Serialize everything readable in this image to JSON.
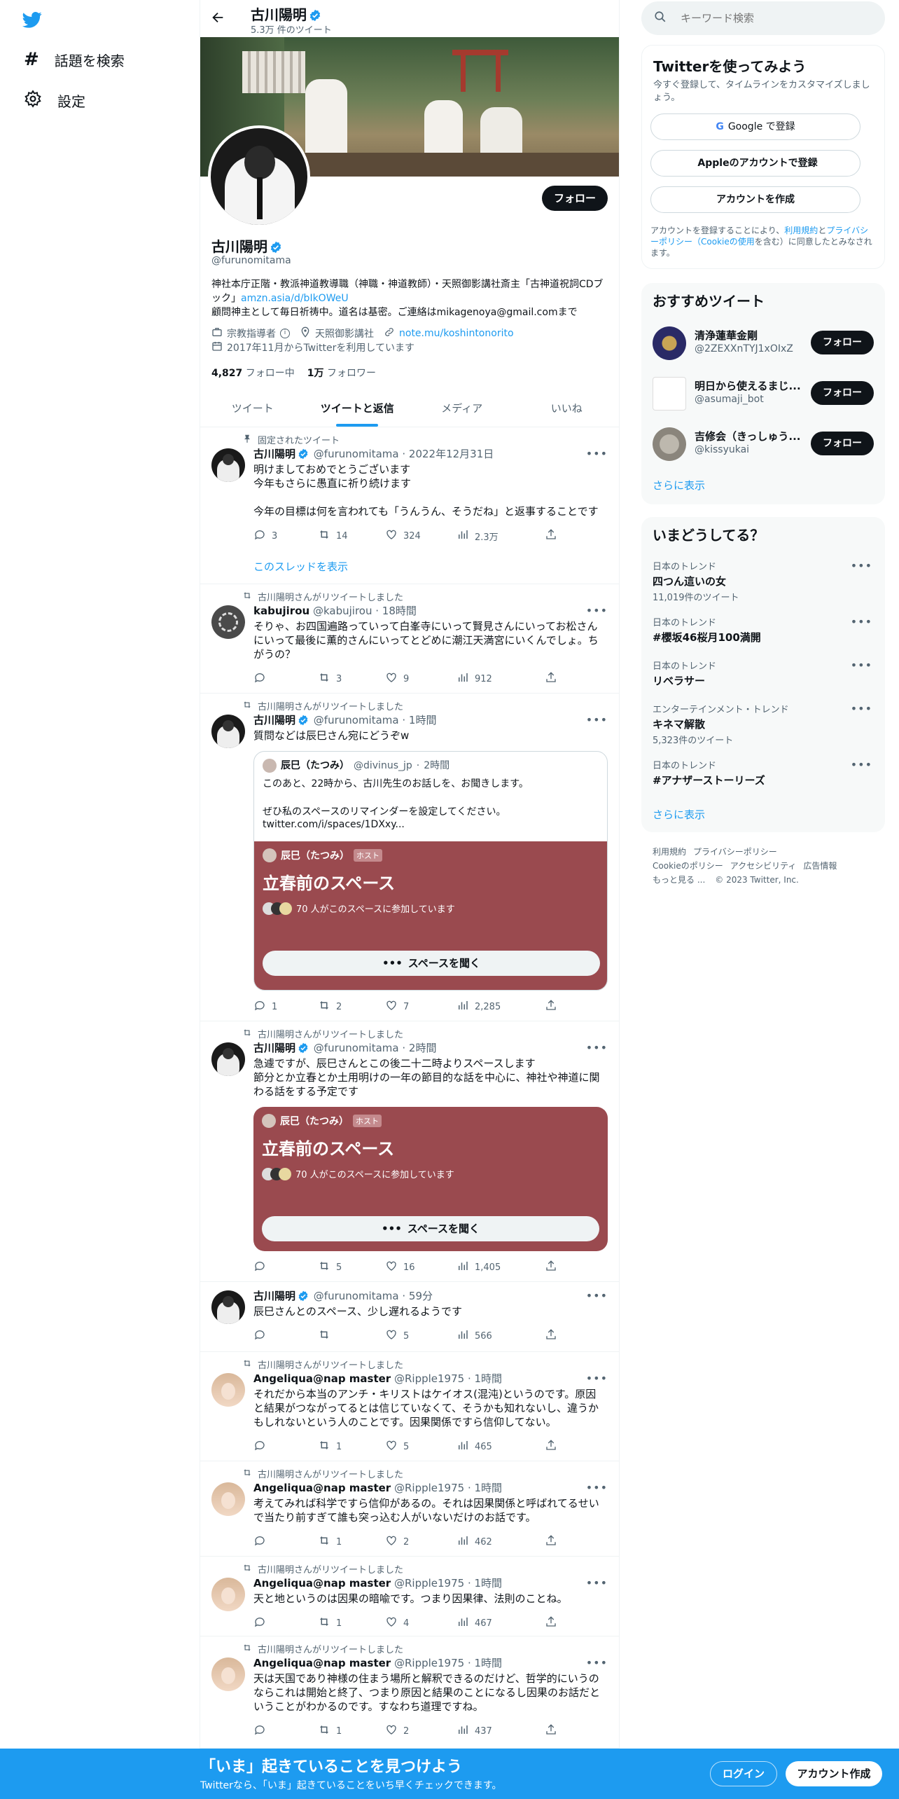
{
  "left_nav": {
    "explore": "話題を検索",
    "settings": "設定"
  },
  "header": {
    "name": "古川陽明",
    "tweet_count": "5.3万 件のツイート"
  },
  "profile": {
    "name": "古川陽明",
    "handle": "@furunomitama",
    "follow": "フォロー",
    "bio_1": "神社本庁正階・教派神道教導職（神職・神道教師）・天照御影講社斎主「古神道祝詞CDブック」",
    "bio_link": "amzn.asia/d/bIkOWeU",
    "bio_2": "顧問神主として毎日祈祷中。道名は基密。ご連絡はmikagenoya@gmail.comまで",
    "category": "宗教指導者",
    "location": "天照御影講社",
    "website": "note.mu/koshintonorito",
    "joined": "2017年11月からTwitterを利用しています",
    "following_count": "4,827",
    "following_label": "フォロー中",
    "followers_count": "1万",
    "followers_label": "フォロワー"
  },
  "tabs": [
    "ツイート",
    "ツイートと返信",
    "メディア",
    "いいね"
  ],
  "pinned_label": "固定されたツイート",
  "show_thread": "このスレッドを表示",
  "retweeted_label": "古川陽明さんがリツイートしました",
  "tweets": [
    {
      "name": "古川陽明",
      "handle": "@furunomitama",
      "time": "2022年12月31日",
      "text": "明けましておめでとうございます\n今年もさらに愚直に祈り続けます\n\n今年の目標は何を言われても「うんうん、そうだね」と返事することです",
      "reply": "3",
      "rt": "14",
      "like": "324",
      "views": "2.3万"
    },
    {
      "name": "kabujirou",
      "handle": "@kabujirou",
      "time": "18時間",
      "text": "そりゃ、お四国遍路っていって白峯寺にいって賢見さんにいってお松さんにいって最後に薫的さんにいってとどめに潮江天満宮にいくんでしょ。ちがうの？",
      "reply": "",
      "rt": "3",
      "like": "9",
      "views": "912"
    },
    {
      "name": "古川陽明",
      "handle": "@furunomitama",
      "time": "1時間",
      "text": "質問などは辰巳さん宛にどうぞw",
      "reply": "1",
      "rt": "2",
      "like": "7",
      "views": "2,285"
    },
    {
      "name": "古川陽明",
      "handle": "@furunomitama",
      "time": "2時間",
      "text": "急遽ですが、辰巳さんとこの後二十二時よりスペースします\n節分とか立春とか土用明けの一年の節目的な話を中心に、神社や神道に関わる話をする予定です",
      "reply": "",
      "rt": "5",
      "like": "16",
      "views": "1,405"
    },
    {
      "name": "古川陽明",
      "handle": "@furunomitama",
      "time": "59分",
      "text": "辰巳さんとのスペース、少し遅れるようです",
      "reply": "",
      "rt": "",
      "like": "5",
      "views": "566"
    },
    {
      "name": "Angeliqua@nap master",
      "handle": "@Ripple1975",
      "time": "1時間",
      "text": "それだから本当のアンチ・キリストはケイオス(混沌)というのです。原因と結果がつながってるとは信じていなくて、そうかも知れないし、違うかもしれないという人のことです。因果関係ですら信仰してない。",
      "reply": "",
      "rt": "1",
      "like": "5",
      "views": "465"
    },
    {
      "name": "Angeliqua@nap master",
      "handle": "@Ripple1975",
      "time": "1時間",
      "text": "考えてみれば科学ですら信仰があるの。それは因果関係と呼ばれてるせいで当たり前すぎて誰も突っ込む人がいないだけのお話です。",
      "reply": "",
      "rt": "1",
      "like": "2",
      "views": "462"
    },
    {
      "name": "Angeliqua@nap master",
      "handle": "@Ripple1975",
      "time": "1時間",
      "text": "天と地というのは因果の暗喩です。つまり因果律、法則のことね。",
      "reply": "",
      "rt": "1",
      "like": "4",
      "views": "467"
    },
    {
      "name": "Angeliqua@nap master",
      "handle": "@Ripple1975",
      "time": "1時間",
      "text": "天は天国であり神様の住まう場所と解釈できるのだけど、哲学的にいうのならこれは開始と終了、つまり原因と結果のことになるし因果のお話だということがわかるのです。すなわち道理ですね。",
      "reply": "",
      "rt": "1",
      "like": "2",
      "views": "437"
    }
  ],
  "quote": {
    "name": "辰巳（たつみ）",
    "handle": "@divinus_jp",
    "time": "2時間",
    "text": "このあと、22時から、古川先生のお話しを、お聞きします。\n\nぜひ私のスペースのリマインダーを設定してください。",
    "link": "twitter.com/i/spaces/1DXxy..."
  },
  "space": {
    "host_name": "辰巳（たつみ）",
    "host_badge": "ホスト",
    "title": "立春前のスペース",
    "participants": "70 人がこのスペースに参加しています",
    "listen": "スペースを聞く"
  },
  "search": {
    "placeholder": "キーワード検索"
  },
  "signup": {
    "title": "Twitterを使ってみよう",
    "sub": "今すぐ登録して、タイムラインをカスタマイズしましょう。",
    "google": "Google で登録",
    "apple": "Appleのアカウントで登録",
    "create": "アカウントを作成",
    "legal_1": "アカウントを登録することにより、",
    "legal_terms": "利用規約",
    "legal_and": "と",
    "legal_privacy": "プライバシーポリシー（Cookieの使用",
    "legal_2": "を含む）に同意したとみなされます。"
  },
  "recommend": {
    "title": "おすすめツイート",
    "items": [
      {
        "name": "清浄蓮華金剛",
        "handle": "@2ZEXXnTYJ1xOIxZ",
        "follow": "フォロー"
      },
      {
        "name": "明日から使えるまじ...",
        "handle": "@asumaji_bot",
        "follow": "フォロー"
      },
      {
        "name": "吉修会（きっしゅう...",
        "handle": "@kissyukai",
        "follow": "フォロー"
      }
    ],
    "more": "さらに表示"
  },
  "trends": {
    "title": "いまどうしてる？",
    "items": [
      {
        "cat": "日本のトレンド",
        "name": "四つん這いの女",
        "count": "11,019件のツイート"
      },
      {
        "cat": "日本のトレンド",
        "name": "#櫻坂46桜月100満開",
        "count": ""
      },
      {
        "cat": "日本のトレンド",
        "name": "リベラサー",
        "count": ""
      },
      {
        "cat": "エンターテインメント・トレンド",
        "name": "キネマ解散",
        "count": "5,323件のツイート"
      },
      {
        "cat": "日本のトレンド",
        "name": "#アナザーストーリーズ",
        "count": ""
      }
    ],
    "more": "さらに表示"
  },
  "footer": {
    "terms": "利用規約",
    "privacy": "プライバシーポリシー",
    "cookie": "Cookieのポリシー",
    "access": "アクセシビリティ",
    "ads": "広告情報",
    "more": "もっと見る ...",
    "copy": "© 2023 Twitter, Inc."
  },
  "bottom_bar": {
    "title": "「いま」起きていることを見つけよう",
    "sub": "Twitterなら、「いま」起きていることをいち早くチェックできます。",
    "login": "ログイン",
    "signup": "アカウント作成"
  },
  "colors": {
    "accent": "#1d9bf0",
    "space": "#9a4a4f",
    "bottom_bar": "#1d9bf0"
  }
}
